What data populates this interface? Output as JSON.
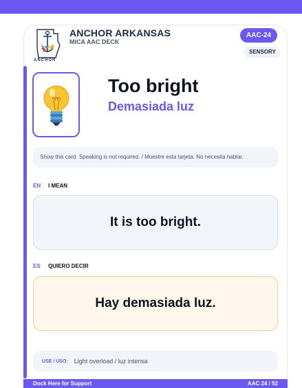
{
  "header": {
    "brand_title": "ANCHOR ARKANSAS",
    "brand_sub": "MICA AAC DECK",
    "logo_word": "ANCHOR",
    "card_id": "AAC-24",
    "category": "SENSORY"
  },
  "card": {
    "icon": "lightbulb-icon",
    "title_en": "Too bright",
    "title_es": "Demasiada luz",
    "instruction": "Show this card. Speaking is not required. / Muestre esta tarjeta. No necesita hablar."
  },
  "phrase_en": {
    "lang": "EN",
    "label": "I MEAN",
    "text": "It is too bright."
  },
  "phrase_es": {
    "lang": "ES",
    "label": "QUIERO DECIR",
    "text": "Hay demasiada luz."
  },
  "use": {
    "label": "USE / USO:",
    "text": "Light overload / luz intensa"
  },
  "footer": {
    "left": "Dock Here for Support",
    "right": "AAC 24 / 52"
  },
  "colors": {
    "accent": "#6b57f2",
    "text": "#0e1321",
    "es_bg": "#fff7eb",
    "es_border": "#f0cf92"
  }
}
